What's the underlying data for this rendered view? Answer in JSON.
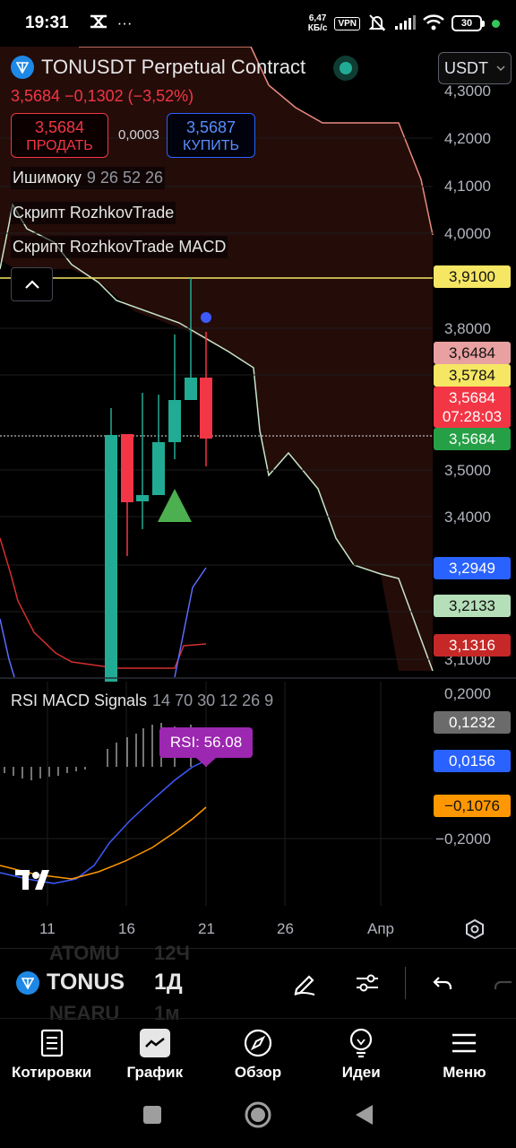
{
  "status_bar": {
    "time": "19:31",
    "net_speed_value": "6,47",
    "net_speed_unit": "КБ/с",
    "vpn": "VPN",
    "battery": "30",
    "more": "···"
  },
  "header": {
    "symbol_title": "TONUSDT Perpetual Contract",
    "currency": "USDT",
    "price_change": "3,5684 −0,1302 (−3,52%)",
    "sell_price": "3,5684",
    "sell_label": "ПРОДАТЬ",
    "spread": "0,0003",
    "buy_price": "3,5687",
    "buy_label": "КУПИТЬ"
  },
  "indicators": [
    {
      "name": "Ишимоку",
      "params": "9 26 52 26"
    },
    {
      "name": "Скрипт RozhkovTrade",
      "params": ""
    },
    {
      "name": "Скрипт RozhkovTrade MACD",
      "params": ""
    }
  ],
  "price_axis": [
    "4,3000",
    "4,2000",
    "4,1000",
    "4,0000",
    "3,8000",
    "3,5000",
    "3,4000",
    "3,1000"
  ],
  "price_tags": {
    "level_3910": "3,9100",
    "level_3648": "3,6484",
    "level_3578": "3,5784",
    "current_price": "3,5684",
    "countdown": "07:28:03",
    "level_3568_green": "3,5684",
    "level_3294": "3,2949",
    "level_3213": "3,2133",
    "level_3131": "3,1316"
  },
  "rsi_panel": {
    "title": "RSI MACD Signals",
    "params": "14 70 30 12 26 9",
    "badge": "RSI: 56.08",
    "axis_top": "0,2000",
    "axis_bottom": "−0,2000",
    "tag_gray": "0,1232",
    "tag_blue": "0,0156",
    "tag_orange": "−0,1076"
  },
  "time_axis": [
    "11",
    "16",
    "21",
    "26",
    "Апр"
  ],
  "toolbar": {
    "symbol": "TONUS",
    "interval": "1Д",
    "ghost_above_symbol": "ATOMU",
    "ghost_above_interval": "12Ч",
    "ghost_below_symbol": "NEARU",
    "ghost_below_interval": "1м"
  },
  "bottom_nav": [
    {
      "label": "Котировки",
      "icon": "quotes-icon"
    },
    {
      "label": "График",
      "icon": "chart-icon"
    },
    {
      "label": "Обзор",
      "icon": "compass-icon"
    },
    {
      "label": "Идеи",
      "icon": "lightbulb-icon"
    },
    {
      "label": "Меню",
      "icon": "menu-icon"
    }
  ],
  "colors": {
    "up": "#22ab94",
    "down": "#f23645",
    "buy_blue": "#2962ff",
    "rsi_purple": "#9c27b0"
  }
}
